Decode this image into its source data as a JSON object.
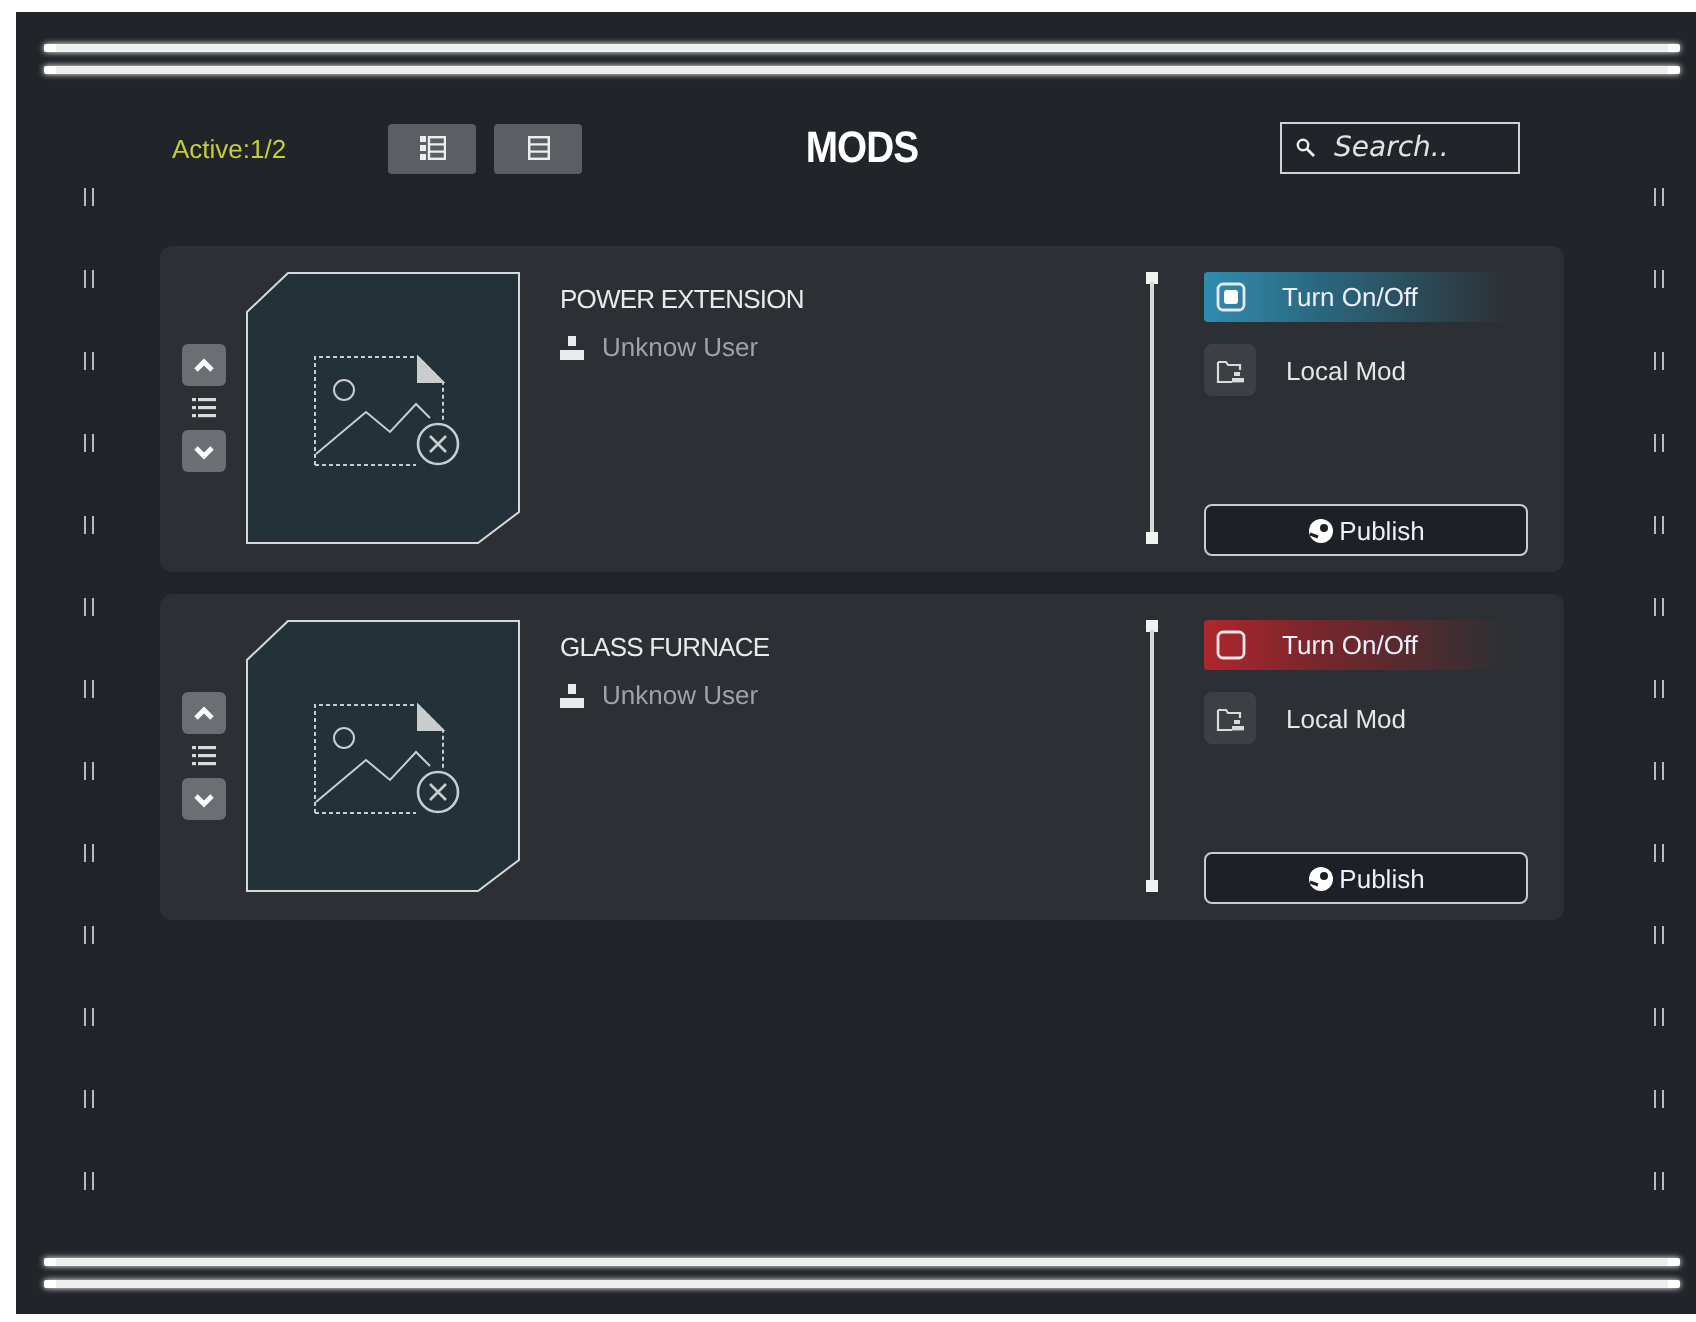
{
  "header": {
    "active_count": "Active:1/2",
    "title": "MODS",
    "search": {
      "placeholder": "Search.."
    }
  },
  "mods": [
    {
      "name": "POWER EXTENSION",
      "author": "Unknow User",
      "enabled": true,
      "toggle_label": "Turn On/Off",
      "source": "Local Mod",
      "publish": "Publish"
    },
    {
      "name": "GLASS FURNACE",
      "author": "Unknow User",
      "enabled": false,
      "toggle_label": "Turn On/Off",
      "source": "Local Mod",
      "publish": "Publish"
    }
  ]
}
